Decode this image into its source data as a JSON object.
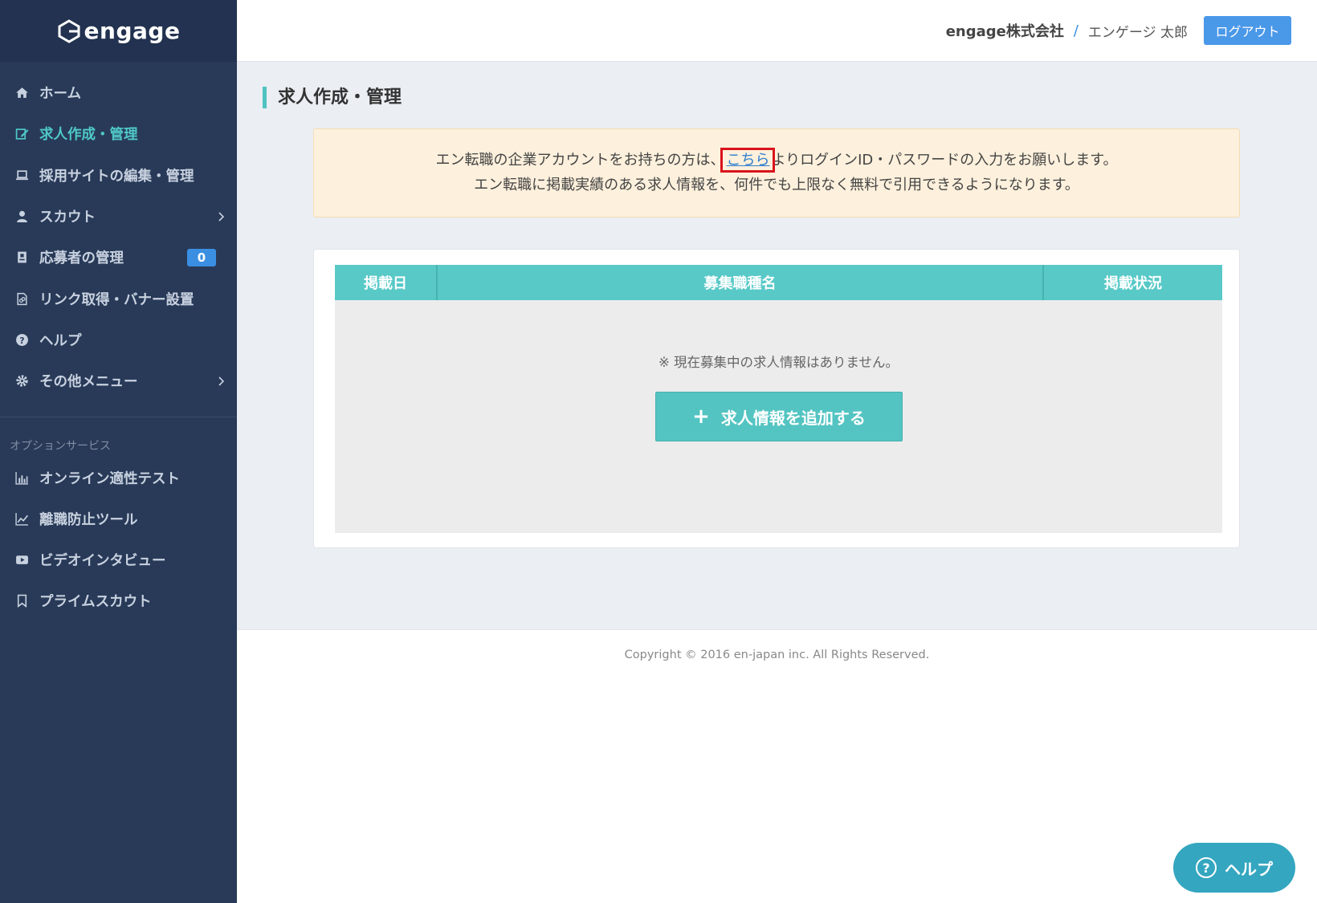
{
  "brand": {
    "logo_text": "engage"
  },
  "sidebar": {
    "items": [
      {
        "label": "ホーム",
        "icon": "home-icon"
      },
      {
        "label": "求人作成・管理",
        "icon": "edit-icon",
        "active": true
      },
      {
        "label": "採用サイトの編集・管理",
        "icon": "laptop-icon"
      },
      {
        "label": "スカウト",
        "icon": "user-icon",
        "has_submenu": true
      },
      {
        "label": "応募者の管理",
        "icon": "id-card-icon",
        "badge": "0"
      },
      {
        "label": "リンク取得・バナー設置",
        "icon": "file-link-icon"
      },
      {
        "label": "ヘルプ",
        "icon": "question-circle-icon"
      },
      {
        "label": "その他メニュー",
        "icon": "gear-icon",
        "has_submenu": true
      }
    ],
    "section_label": "オプションサービス",
    "option_items": [
      {
        "label": "オンライン適性テスト",
        "icon": "bar-chart-icon"
      },
      {
        "label": "離職防止ツール",
        "icon": "line-chart-icon"
      },
      {
        "label": "ビデオインタビュー",
        "icon": "video-play-icon"
      },
      {
        "label": "プライムスカウト",
        "icon": "bookmark-icon"
      }
    ]
  },
  "header": {
    "company": "engage株式会社",
    "separator": "/",
    "username": "エンゲージ 太郎",
    "logout_label": "ログアウト"
  },
  "main": {
    "page_title": "求人作成・管理",
    "notice": {
      "line1_before": "エン転職の企業アカウントをお持ちの方は、",
      "link_text": "こちら",
      "line1_after": "よりログインID・パスワードの入力をお願いします。",
      "line2": "エン転職に掲載実績のある求人情報を、何件でも上限なく無料で引用できるようになります。"
    },
    "table": {
      "columns": [
        "掲載日",
        "募集職種名",
        "掲載状況"
      ],
      "empty_message": "※ 現在募集中の求人情報はありません。"
    },
    "add_button_label": "求人情報を追加する",
    "add_button_icon": "plus-icon"
  },
  "footer": {
    "copyright": "Copyright © 2016 en-japan inc. All Rights Reserved."
  },
  "help_button": {
    "label": "ヘルプ",
    "icon": "question-circle-icon"
  },
  "colors": {
    "sidebar_bg": "#283a58",
    "accent_teal": "#58c9c7",
    "logout_blue": "#4a98e8",
    "notice_bg": "#fdf0dc",
    "help_float": "#34a6c0"
  }
}
